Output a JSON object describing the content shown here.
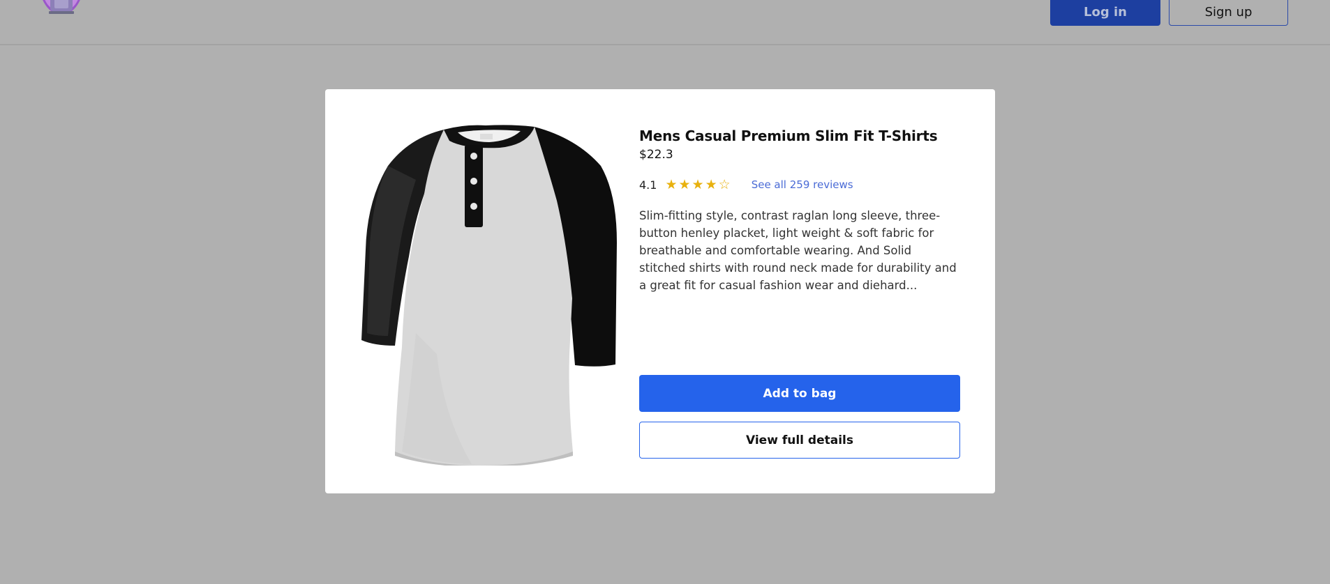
{
  "header": {
    "login_label": "Log in",
    "signup_label": "Sign up"
  },
  "product": {
    "title": "Mens Casual Premium Slim Fit T-Shirts",
    "price": "$22.3",
    "rating": "4.1",
    "rating_stars_filled": 4,
    "rating_stars_total": 5,
    "reviews_link": "See all 259 reviews",
    "description": "Slim-fitting style, contrast raglan long sleeve, three-button henley placket, light weight & soft fabric for breathable and comfortable wearing. And Solid stitched shirts with round neck made for durability and a great fit for casual fashion wear and diehard...",
    "add_to_bag_label": "Add to bag",
    "view_details_label": "View full details"
  },
  "colors": {
    "accent": "#2563eb",
    "star": "#e8b10e",
    "link": "#4a6bd6",
    "overlay": "#b0b0b0"
  }
}
